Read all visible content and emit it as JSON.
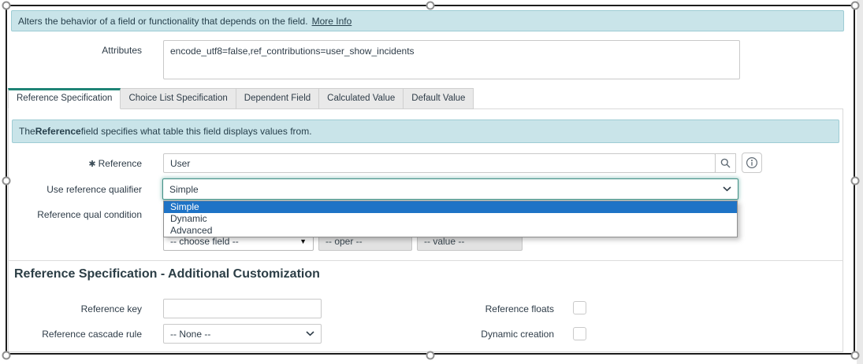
{
  "colors": {
    "banner_bg": "#c9e4e9",
    "banner_border": "#9dccd4",
    "active_tab_accent": "#1f8476",
    "focus_teal": "#418f84",
    "selection_highlight_blue": "#1e73c6",
    "text": "#2e3c48"
  },
  "banner_top": {
    "text": "Alters the behavior of a field or functionality that depends on the field.",
    "link_label": "More Info"
  },
  "attributes_field": {
    "label": "Attributes",
    "value": "encode_utf8=false,ref_contributions=user_show_incidents"
  },
  "tabs": {
    "active": "Reference Specification",
    "items": [
      {
        "label": "Reference Specification"
      },
      {
        "label": "Choice List Specification"
      },
      {
        "label": "Dependent Field"
      },
      {
        "label": "Calculated Value"
      },
      {
        "label": "Default Value"
      }
    ]
  },
  "panel": {
    "banner": {
      "text_prefix": "The ",
      "text_bold": "Reference",
      "text_suffix": " field specifies what table this field displays values from."
    },
    "reference": {
      "required_mark": "✱",
      "label": "Reference",
      "value": "User"
    },
    "qualifier": {
      "label": "Use reference qualifier",
      "value": "Simple",
      "options": [
        "Simple",
        "Dynamic",
        "Advanced"
      ],
      "highlighted_option": "Simple"
    },
    "qual_condition": {
      "label": "Reference qual condition",
      "choose_field_placeholder": "-- choose field --",
      "oper_placeholder": "-- oper --",
      "value_placeholder": "-- value --",
      "dropdown_arrow": "▼"
    },
    "additional": {
      "heading": "Reference Specification - Additional Customization",
      "reference_key": {
        "label": "Reference key",
        "value": ""
      },
      "reference_floats": {
        "label": "Reference floats",
        "checked": false
      },
      "cascade_rule": {
        "label": "Reference cascade rule",
        "value": "-- None --"
      },
      "dynamic_creation": {
        "label": "Dynamic creation",
        "checked": false
      }
    }
  },
  "icons": {
    "search": "⌕",
    "info": "ⓘ",
    "chevron_down": "⌄",
    "dropdown_arrow": "▼"
  }
}
